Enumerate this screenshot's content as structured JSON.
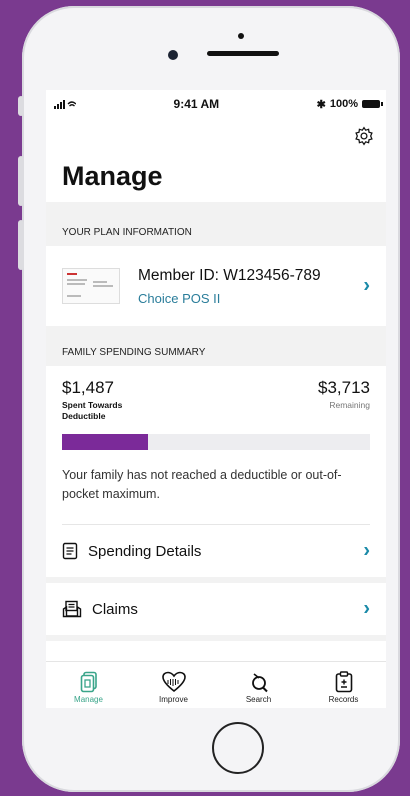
{
  "status_bar": {
    "time": "9:41 AM",
    "battery": "100%"
  },
  "page": {
    "title": "Manage"
  },
  "plan_info": {
    "heading": "YOUR PLAN INFORMATION",
    "member_id": "Member ID: W123456-789",
    "plan_name": "Choice POS II"
  },
  "spending": {
    "heading": "FAMILY SPENDING SUMMARY",
    "spent_amount": "$1,487",
    "spent_label": "Spent Towards Deductible",
    "remaining_amount": "$3,713",
    "remaining_label": "Remaining",
    "progress_fraction": 0.28,
    "note": "Your family has not reached a deductible or out-of-pocket maximum."
  },
  "links": {
    "spending_details": "Spending Details",
    "claims": "Claims"
  },
  "tabs": [
    {
      "label": "Manage",
      "icon": "manage-icon",
      "active": true
    },
    {
      "label": "Improve",
      "icon": "heart-icon",
      "active": false
    },
    {
      "label": "Search",
      "icon": "search-icon",
      "active": false
    },
    {
      "label": "Records",
      "icon": "clipboard-icon",
      "active": false
    }
  ],
  "colors": {
    "accent": "#7b2a99",
    "link": "#1a8aa8",
    "tab_active": "#3aa58a",
    "background": "#7a3a8f"
  }
}
